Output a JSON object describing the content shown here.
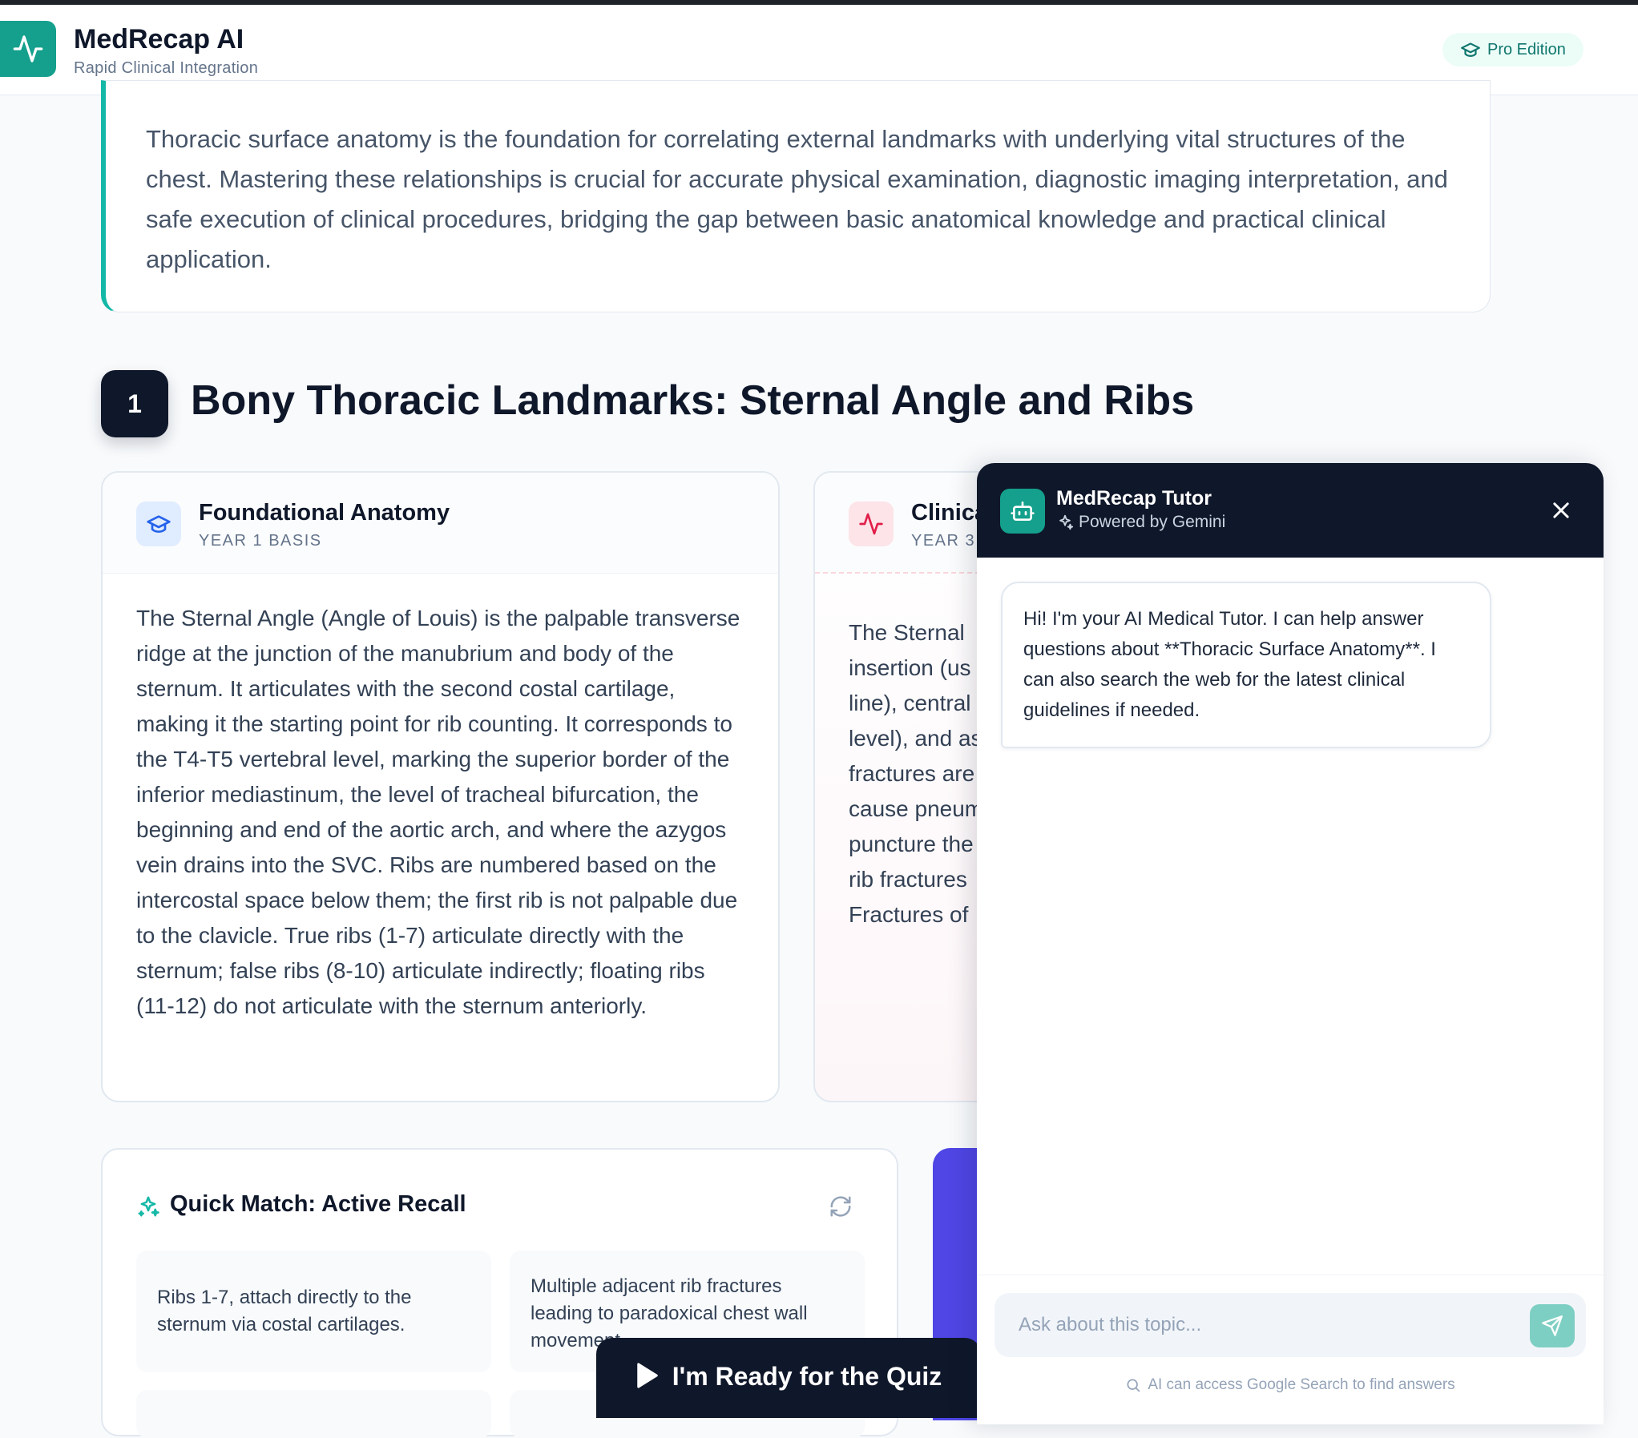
{
  "header": {
    "app_title": "MedRecap AI",
    "app_subtitle": "Rapid Clinical Integration",
    "badge": "Pro Edition",
    "logo_icon": "activity-icon",
    "accent": "#14a08c"
  },
  "intro": {
    "text": "Thoracic surface anatomy is the foundation for correlating external landmarks with underlying vital structures of the chest. Mastering these relationships is crucial for accurate physical examination, diagnostic imaging interpretation, and safe execution of clinical procedures, bridging the gap between basic anatomical knowledge and practical clinical application."
  },
  "section": {
    "number": "1",
    "title": "Bony Thoracic Landmarks: Sternal Angle and Ribs"
  },
  "cards": {
    "foundational": {
      "title": "Foundational Anatomy",
      "tag": "YEAR 1 BASIS",
      "body": "The Sternal Angle (Angle of Louis) is the palpable transverse ridge at the junction of the manubrium and body of the sternum. It articulates with the second costal cartilage, making it the starting point for rib counting. It corresponds to the T4-T5 vertebral level, marking the superior border of the inferior mediastinum, the level of tracheal bifurcation, the beginning and end of the aortic arch, and where the azygos vein drains into the SVC. Ribs are numbered based on the intercostal space below them; the first rib is not palpable due to the clavicle. True ribs (1-7) articulate directly with the sternum; false ribs (8-10) articulate indirectly; floating ribs (11-12) do not articulate with the sternum anteriorly."
    },
    "clinical": {
      "title": "Clinica",
      "tag": "YEAR 3",
      "lines": [
        "The Sternal",
        "insertion (us",
        "line), central",
        "level), and as",
        "fractures are",
        "cause pneum",
        "puncture the",
        "rib fractures",
        "Fractures of"
      ]
    }
  },
  "quiz": {
    "title": "Quick Match: Active Recall",
    "items": [
      "Ribs 1-7, attach directly to the sternum via costal cartilages.",
      "Multiple adjacent rib fractures leading to paradoxical chest wall movement."
    ]
  },
  "ready_button": "I'm Ready for the Quiz",
  "chat": {
    "title": "MedRecap Tutor",
    "powered": "Powered by Gemini",
    "message": "Hi! I'm your AI Medical Tutor. I can help answer questions about **Thoracic Surface Anatomy**. I can also search the web for the latest clinical guidelines if needed.",
    "placeholder": "Ask about this topic...",
    "note": "AI can access Google Search to find answers"
  }
}
